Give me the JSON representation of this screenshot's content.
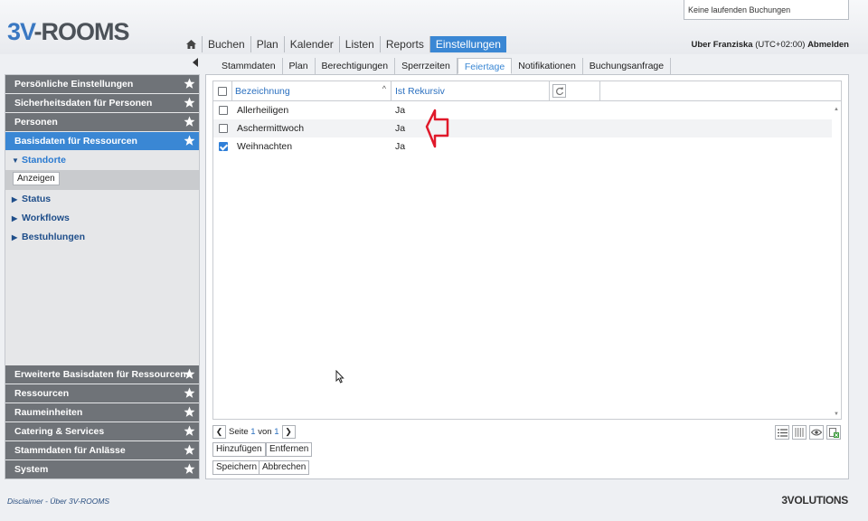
{
  "app": {
    "logo_prefix": "3V",
    "logo_suffix": "-ROOMS"
  },
  "booking_status": "Keine laufenden Buchungen",
  "topnav": [
    {
      "label": "Buchen"
    },
    {
      "label": "Plan"
    },
    {
      "label": "Kalender"
    },
    {
      "label": "Listen"
    },
    {
      "label": "Reports"
    },
    {
      "label": "Einstellungen"
    }
  ],
  "user": {
    "prefix": "Uber Franziska",
    "timezone": "(UTC+02:00)",
    "logout": "Abmelden"
  },
  "sidebar": {
    "top_sections": [
      {
        "label": "Persönliche Einstellungen"
      },
      {
        "label": "Sicherheitsdaten für Personen"
      },
      {
        "label": "Personen"
      },
      {
        "label": "Basisdaten für Ressourcen"
      }
    ],
    "sub_items": [
      {
        "label": "Standorte"
      },
      {
        "label": "Status"
      },
      {
        "label": "Workflows"
      },
      {
        "label": "Bestuhlungen"
      }
    ],
    "show_button": "Anzeigen",
    "bottom_sections": [
      {
        "label": "Erweiterte Basisdaten für Ressourcen"
      },
      {
        "label": "Ressourcen"
      },
      {
        "label": "Raumeinheiten"
      },
      {
        "label": "Catering & Services"
      },
      {
        "label": "Stammdaten für Anlässe"
      },
      {
        "label": "System"
      }
    ]
  },
  "tabs": [
    {
      "label": "Stammdaten"
    },
    {
      "label": "Plan"
    },
    {
      "label": "Berechtigungen"
    },
    {
      "label": "Sperrzeiten"
    },
    {
      "label": "Feiertage"
    },
    {
      "label": "Notifikationen"
    },
    {
      "label": "Buchungsanfrage"
    }
  ],
  "grid": {
    "columns": {
      "name": "Bezeichnung",
      "recursive": "Ist Rekursiv"
    },
    "rows": [
      {
        "name": "Allerheiligen",
        "recursive": "Ja",
        "checked": false
      },
      {
        "name": "Aschermittwoch",
        "recursive": "Ja",
        "checked": false
      },
      {
        "name": "Weihnachten",
        "recursive": "Ja",
        "checked": true
      }
    ]
  },
  "pager": {
    "page_label": "Seite",
    "page": "1",
    "of_label": "von",
    "total": "1"
  },
  "buttons": {
    "add": "Hinzufügen",
    "remove": "Entfernen",
    "save": "Speichern",
    "cancel": "Abbrechen"
  },
  "footer": {
    "disclaimer": "Disclaimer",
    "separator": "-",
    "about": "Über 3V-ROOMS",
    "brand": "3VOLUTIONS"
  },
  "colors": {
    "accent": "#3a87d4",
    "sidebar_section": "#6f7378",
    "annotation": "#e0192a"
  }
}
